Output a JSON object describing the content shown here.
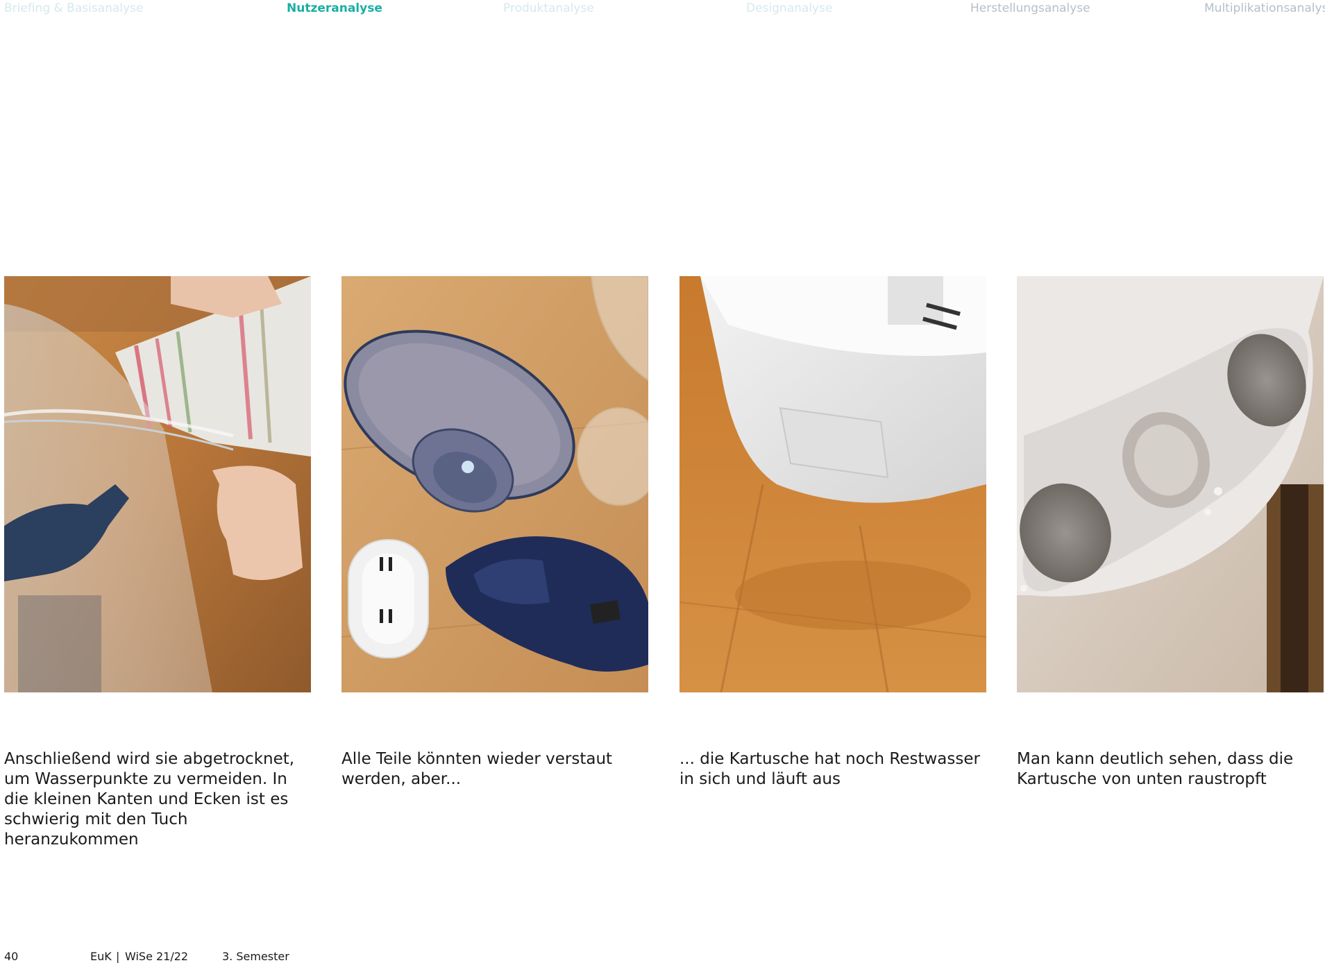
{
  "nav": {
    "items": [
      {
        "label": "Briefing & Basisanalyse"
      },
      {
        "label": "Nutzeranalyse"
      },
      {
        "label": "Produktanalyse"
      },
      {
        "label": "Designanalyse"
      },
      {
        "label": "Herstellungsanalyse"
      },
      {
        "label": "Multiplikationsanalyse"
      }
    ]
  },
  "photos": [
    {
      "caption": "Anschließend wird sie abgetrocknet, um Wasserpunkte zu vermeiden. In die kleinen Kanten und Ecken ist es schwierig mit den Tuch heranzukommen"
    },
    {
      "caption": "Alle Teile könnten wieder verstaut werden, aber..."
    },
    {
      "caption": "... die Kartusche hat noch Restwasser in sich und läuft aus"
    },
    {
      "caption": "Man kann deutlich sehen, dass die Kartusche von unten raustropft"
    }
  ],
  "footer": {
    "page_number": "40",
    "course": "EuK",
    "separator": "|",
    "term": "WiSe 21/22",
    "semester": "3. Semester"
  },
  "colors": {
    "accent": "#1aaea4",
    "nav_faint": "#d3eaec",
    "nav_mid": "#b4c0c8",
    "text": "#1a1a1a"
  }
}
